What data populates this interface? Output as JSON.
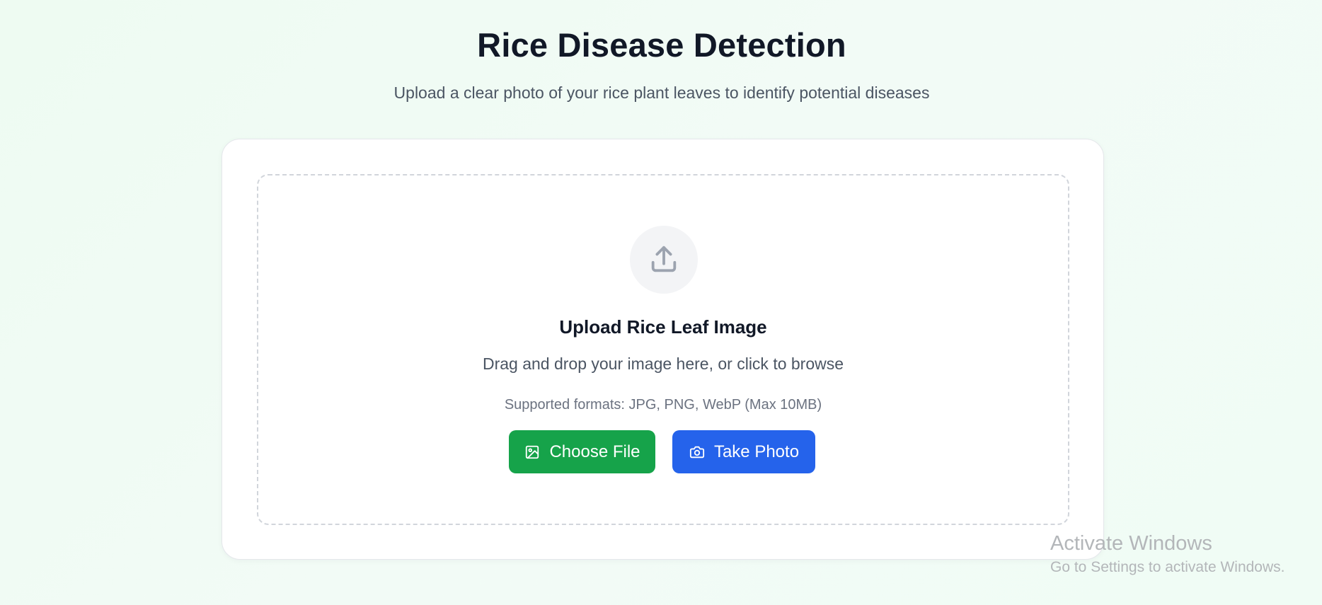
{
  "header": {
    "title": "Rice Disease Detection",
    "subtitle": "Upload a clear photo of your rice plant leaves to identify potential diseases"
  },
  "upload": {
    "icon": "upload-icon",
    "title": "Upload Rice Leaf Image",
    "description": "Drag and drop your image here, or click to browse",
    "formats": "Supported formats: JPG, PNG, WebP (Max 10MB)"
  },
  "buttons": {
    "choose_file": {
      "label": "Choose File",
      "icon": "image-icon",
      "color": "#16a34a"
    },
    "take_photo": {
      "label": "Take Photo",
      "icon": "camera-icon",
      "color": "#2563eb"
    }
  },
  "watermark": {
    "title": "Activate Windows",
    "subtitle": "Go to Settings to activate Windows."
  }
}
